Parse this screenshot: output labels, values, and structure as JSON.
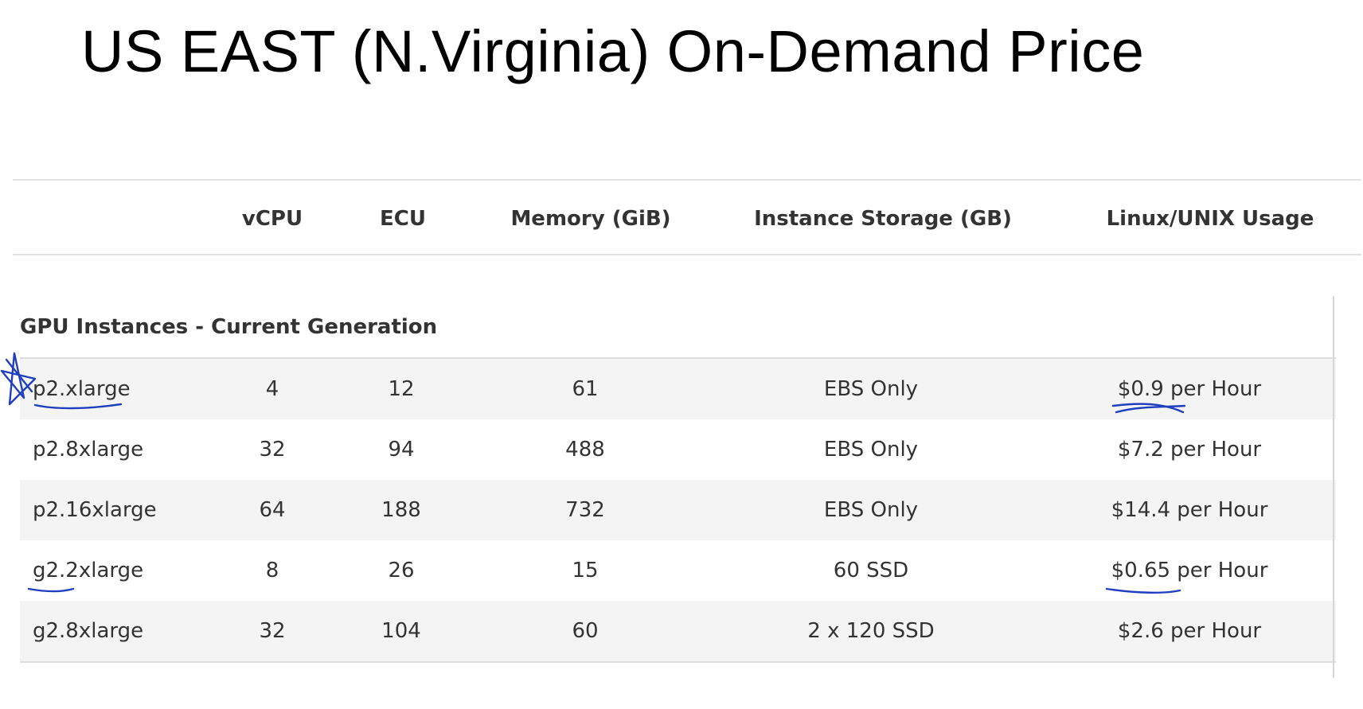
{
  "title": "US EAST (N.Virginia) On-Demand Price",
  "table": {
    "columns": [
      "",
      "vCPU",
      "ECU",
      "Memory (GiB)",
      "Instance Storage (GB)",
      "Linux/UNIX Usage"
    ],
    "section": "GPU Instances - Current Generation",
    "rows": [
      {
        "name": "p2.xlarge",
        "vcpu": "4",
        "ecu": "12",
        "memory": "61",
        "storage": "EBS Only",
        "price": "$0.9 per Hour"
      },
      {
        "name": "p2.8xlarge",
        "vcpu": "32",
        "ecu": "94",
        "memory": "488",
        "storage": "EBS Only",
        "price": "$7.2 per Hour"
      },
      {
        "name": "p2.16xlarge",
        "vcpu": "64",
        "ecu": "188",
        "memory": "732",
        "storage": "EBS Only",
        "price": "$14.4 per Hour"
      },
      {
        "name": "g2.2xlarge",
        "vcpu": "8",
        "ecu": "26",
        "memory": "15",
        "storage": "60 SSD",
        "price": "$0.65 per Hour"
      },
      {
        "name": "g2.8xlarge",
        "vcpu": "32",
        "ecu": "104",
        "memory": "60",
        "storage": "2 x 120 SSD",
        "price": "$2.6 per Hour"
      }
    ]
  },
  "annotations": {
    "ink_color": "#1f3fbf"
  }
}
